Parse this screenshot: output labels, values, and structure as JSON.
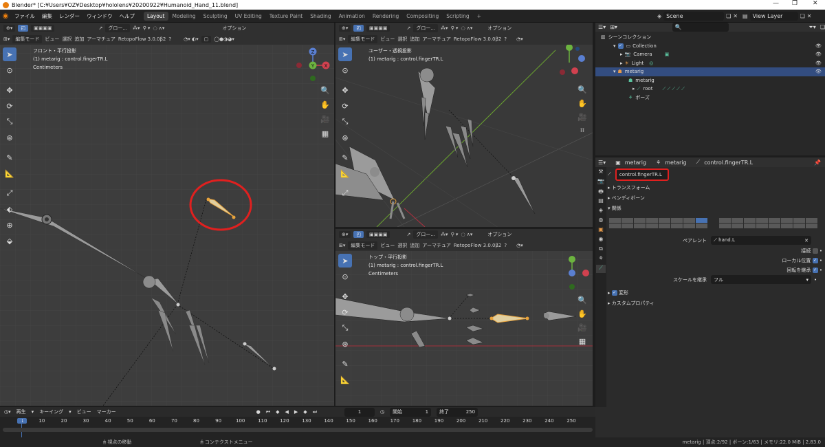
{
  "window": {
    "title": "Blender* [C:¥Users¥OZ¥Desktop¥hololens¥20200922¥Humanoid_Hand_11.blend]"
  },
  "menu": {
    "items": [
      "ファイル",
      "編集",
      "レンダー",
      "ウィンドウ",
      "ヘルプ"
    ]
  },
  "workspaces": [
    "Layout",
    "Modeling",
    "Sculpting",
    "UV Editing",
    "Texture Paint",
    "Shading",
    "Animation",
    "Rendering",
    "Compositing",
    "Scripting"
  ],
  "workspace_add": "+",
  "scene": {
    "label": "Scene",
    "view_layer": "View Layer"
  },
  "viewport_header": {
    "mode": "編集モード",
    "view": "ビュー",
    "select": "選択",
    "add": "追加",
    "armature": "アーマチュア",
    "addon": "RetopoFlow 3.0.0β2",
    "orientation": "グロー...",
    "options": "オプション",
    "x_label": "X"
  },
  "viewports": {
    "left": {
      "projection": "フロント・平行投影",
      "object": "(1) metarig : control.fingerTR.L",
      "units": "Centimeters"
    },
    "topright": {
      "projection": "ユーザー・透視投影",
      "object": "(1) metarig : control.fingerTR.L"
    },
    "bottomright": {
      "projection": "トップ・平行投影",
      "object": "(1) metarig : control.fingerTR.L",
      "units": "Centimeters"
    }
  },
  "gizmo": {
    "z": "Z",
    "y": "Y",
    "x": "X"
  },
  "outliner": {
    "search_placeholder": "",
    "rows": [
      "シーンコレクション",
      "Collection",
      "Camera",
      "Light",
      "metarig",
      "metarig",
      "root",
      "ポーズ"
    ]
  },
  "properties": {
    "breadcrumb": [
      "metarig",
      "metarig",
      "control.fingerTR.L"
    ],
    "bone_name": "control.fingerTR.L",
    "panels": {
      "transform": "トランスフォーム",
      "bendy": "ベンディボーン",
      "relations": "関係",
      "deform": "変形",
      "custom": "カスタムプロパティ"
    },
    "parent_label": "ペアレント",
    "parent_value": "hand.L",
    "connected_label": "接続",
    "local_location_label": "ローカル位置",
    "inherit_rotation_label": "回転を継承",
    "inherit_scale_label": "スケールを継承",
    "inherit_scale_value": "フル"
  },
  "timeline": {
    "menu": [
      "再生",
      "キーイング",
      "ビュー",
      "マーカー"
    ],
    "current_frame": "1",
    "start_label": "開始",
    "start": "1",
    "end_label": "終了",
    "end": "250",
    "ticks": [
      "1",
      "10",
      "20",
      "30",
      "40",
      "50",
      "60",
      "70",
      "80",
      "90",
      "100",
      "110",
      "120",
      "130",
      "140",
      "150",
      "160",
      "170",
      "180",
      "190",
      "200",
      "210",
      "220",
      "230",
      "240",
      "250"
    ]
  },
  "statusbar": {
    "left": "視点の移動",
    "mid": "コンテクストメニュー",
    "right": "metarig | 頂点:2/92 | ボーン:1/63 | メモリ:22.0 MiB | 2.83.0"
  },
  "colors": {
    "accent": "#4772b3",
    "selected_bone": "#e8a33c",
    "highlight_red": "#e0201f",
    "bone_green": "#25b06a"
  }
}
